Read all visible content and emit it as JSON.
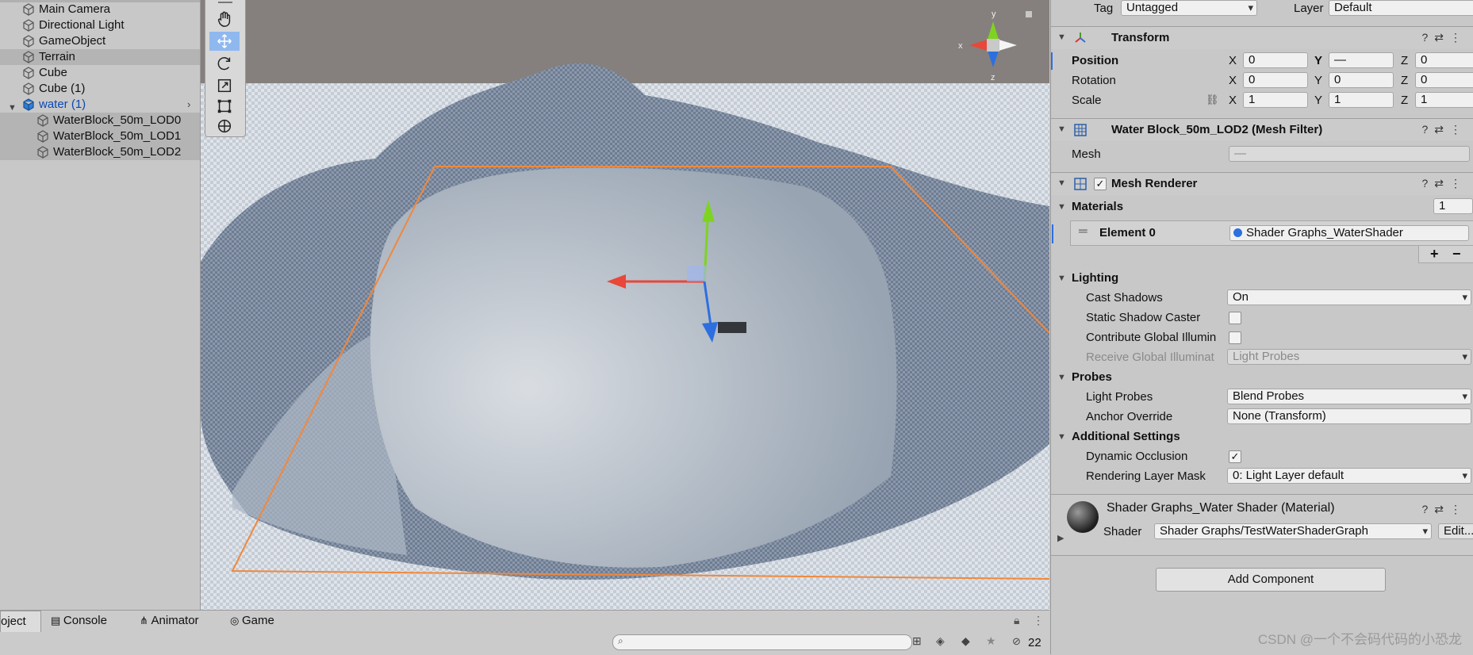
{
  "hierarchy": {
    "items": [
      {
        "label": "Main Camera",
        "indent": 1,
        "selected": false
      },
      {
        "label": "Directional Light",
        "indent": 1,
        "selected": false
      },
      {
        "label": "GameObject",
        "indent": 1,
        "selected": false
      },
      {
        "label": "Terrain",
        "indent": 1,
        "selected": true
      },
      {
        "label": "Cube",
        "indent": 1,
        "selected": false
      },
      {
        "label": "Cube (1)",
        "indent": 1,
        "selected": false
      },
      {
        "label": "water (1)",
        "indent": 1,
        "selected": false,
        "blue": true,
        "expanded": true
      },
      {
        "label": "WaterBlock_50m_LOD0",
        "indent": 2,
        "selected": true
      },
      {
        "label": "WaterBlock_50m_LOD1",
        "indent": 2,
        "selected": true
      },
      {
        "label": "WaterBlock_50m_LOD2",
        "indent": 2,
        "selected": true
      }
    ]
  },
  "scene": {
    "gizmo_axes": {
      "x": "x",
      "y": "y",
      "z": "z"
    },
    "colors": {
      "sky": "#85807d",
      "ground": "#d8dee6",
      "water": "#a9b4c0",
      "terrain": "#9aa6b8",
      "selection": "#f0883c",
      "axis_x": "#e8473a",
      "axis_y": "#7ed321",
      "axis_z": "#2d6fe0"
    }
  },
  "tools": [
    "hand-tool",
    "move-tool",
    "rotate-tool",
    "scale-tool",
    "rect-tool",
    "transform-tool"
  ],
  "inspector": {
    "tag_label": "Tag",
    "tag_value": "Untagged",
    "layer_label": "Layer",
    "layer_value": "Default",
    "transform": {
      "title": "Transform",
      "position_label": "Position",
      "rotation_label": "Rotation",
      "scale_label": "Scale",
      "position": {
        "x": "0",
        "y": "—",
        "z": "0"
      },
      "rotation": {
        "x": "0",
        "y": "0",
        "z": "0"
      },
      "scale": {
        "x": "1",
        "y": "1",
        "z": "1"
      },
      "axis_x": "X",
      "axis_y": "Y",
      "axis_z": "Z"
    },
    "mesh_filter": {
      "title": "Water Block_50m_LOD2 (Mesh Filter)",
      "mesh_label": "Mesh",
      "mesh_value": "—"
    },
    "mesh_renderer": {
      "title": "Mesh Renderer",
      "materials_label": "Materials",
      "materials_count": "1",
      "element_label": "Element 0",
      "element_value": "Shader Graphs_WaterShader",
      "plus": "+",
      "minus": "−",
      "lighting_label": "Lighting",
      "cast_shadows_label": "Cast Shadows",
      "cast_shadows_value": "On",
      "static_shadow_label": "Static Shadow Caster",
      "contribute_gi_label": "Contribute Global Illumin",
      "receive_gi_label": "Receive Global Illuminat",
      "receive_gi_value": "Light Probes",
      "probes_label": "Probes",
      "light_probes_label": "Light Probes",
      "light_probes_value": "Blend Probes",
      "anchor_label": "Anchor Override",
      "anchor_value": "None (Transform)",
      "additional_label": "Additional Settings",
      "dynamic_occlusion_label": "Dynamic Occlusion",
      "dynamic_occlusion_check": "✓",
      "rendering_layer_label": "Rendering Layer Mask",
      "rendering_layer_value": "0: Light Layer default"
    },
    "material": {
      "title": "Shader Graphs_Water Shader (Material)",
      "shader_label": "Shader",
      "shader_value": "Shader Graphs/TestWaterShaderGraph",
      "edit_label": "Edit..."
    },
    "add_component": "Add Component"
  },
  "bottom": {
    "tabs": [
      "oject",
      "Console",
      "Animator",
      "Game"
    ],
    "hidden_count": "22"
  },
  "watermark": "CSDN @一个不会码代码的小恐龙"
}
